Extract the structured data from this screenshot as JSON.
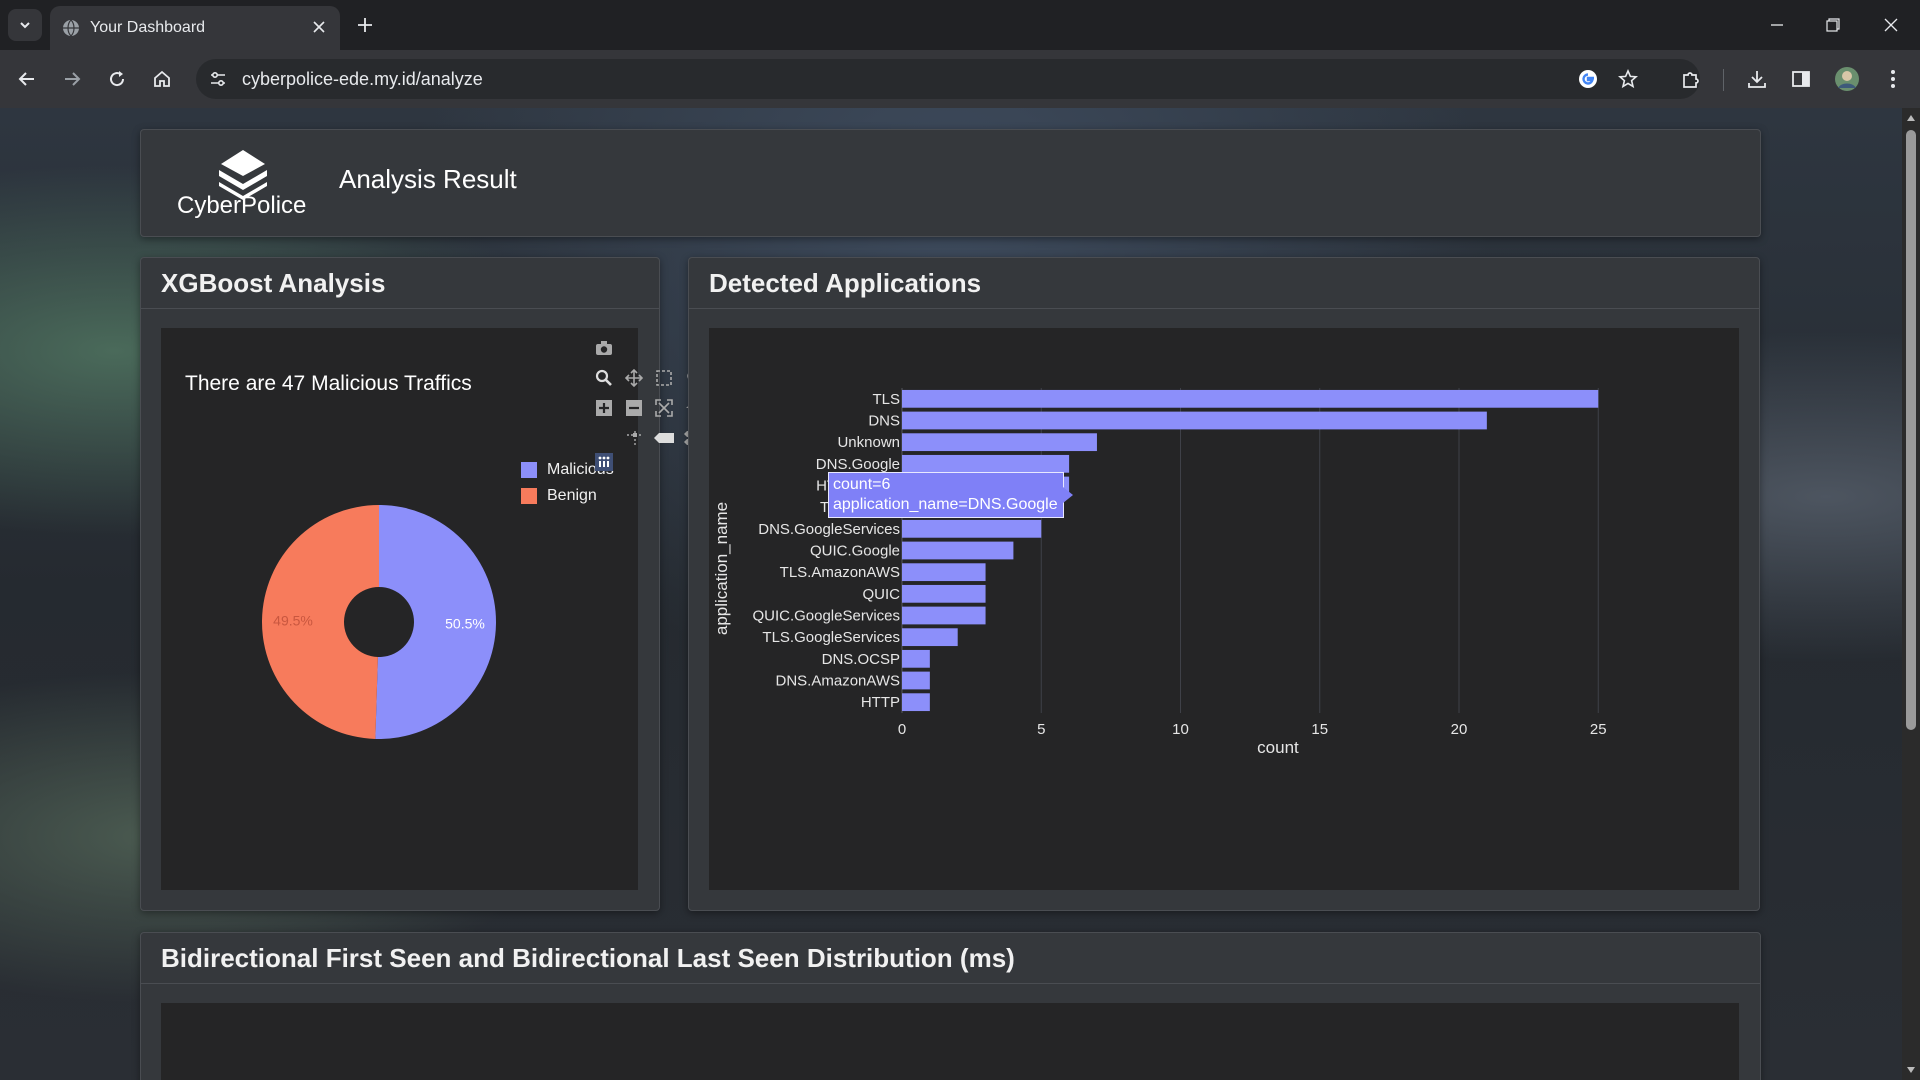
{
  "browser": {
    "tab_title": "Your Dashboard",
    "url": "cyberpolice-ede.my.id/analyze"
  },
  "header": {
    "logo_text": "CyberPolice",
    "page_title": "Analysis Result"
  },
  "xgboost_card": {
    "title": "XGBoost Analysis",
    "plot_title": "There are 47 Malicious Traffics"
  },
  "apps_card": {
    "title": "Detected Applications"
  },
  "distribution_card": {
    "title": "Bidirectional First Seen and Bidirectional Last Seen Distribution (ms)"
  },
  "tooltip": {
    "line1": "count=6",
    "line2": "application_name=DNS.Google"
  },
  "colors": {
    "malicious": "#8c8ffa",
    "benign": "#f77b5c",
    "bar": "#8c8ffa",
    "plot_bg": "#252526"
  },
  "chart_data": [
    {
      "type": "pie",
      "title": "There are 47 Malicious Traffics",
      "labels": [
        "Malicious",
        "Benign"
      ],
      "values": [
        50.5,
        49.5
      ],
      "value_labels": [
        "50.5%",
        "49.5%"
      ],
      "hole": true,
      "legend": "top-right"
    },
    {
      "type": "bar",
      "orientation": "horizontal",
      "categories": [
        "TLS",
        "DNS",
        "Unknown",
        "DNS.Google",
        "HTTP.OCSP",
        "TLS.Google",
        "DNS.GoogleServices",
        "QUIC.Google",
        "TLS.AmazonAWS",
        "QUIC",
        "QUIC.GoogleServices",
        "TLS.GoogleServices",
        "DNS.OCSP",
        "DNS.AmazonAWS",
        "HTTP"
      ],
      "values": [
        25,
        21,
        7,
        6,
        6,
        5,
        5,
        4,
        3,
        3,
        3,
        2,
        1,
        1,
        1
      ],
      "xlabel": "count",
      "ylabel": "application_name",
      "xlim": [
        0,
        27
      ],
      "xticks": [
        "0",
        "5",
        "10",
        "15",
        "20",
        "25"
      ],
      "grid": true
    }
  ]
}
